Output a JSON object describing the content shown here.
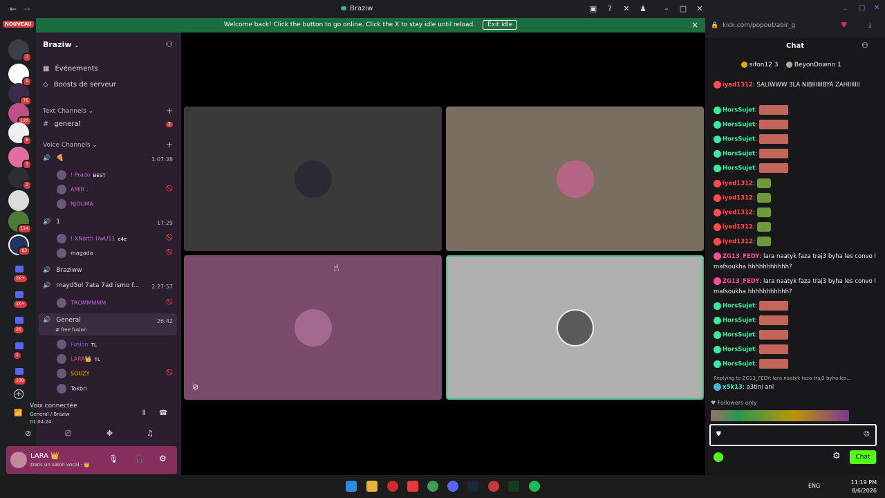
{
  "window": {
    "title": "Braziw",
    "nav_back": "←",
    "nav_forward": "→"
  },
  "banner": {
    "text": "Welcome back! Click the button to go online. Click the X to stay idle until reload.",
    "button": "Exit Idle",
    "close": "×"
  },
  "servers": {
    "nouveau": "NOUVEAU",
    "badges": [
      "7",
      "9",
      "76",
      "120",
      "6",
      "3",
      "2",
      "114",
      "83",
      "1K+",
      "1K+",
      "26",
      "1",
      "108"
    ],
    "add": "+"
  },
  "sidebar": {
    "server_name": "Braziw",
    "events": "Événements",
    "boosts": "Boosts de serveur",
    "text_category": "Text Channels",
    "text_channel": "general",
    "text_channel_badge": "7",
    "voice_category": "Voice Channels",
    "voice_channels": [
      {
        "name": "🍕",
        "timer": "1:07:38"
      },
      {
        "name": "1",
        "timer": "17:29"
      },
      {
        "name": "Braziww",
        "timer": ""
      },
      {
        "name": "mayd5ol 7ata 7ad ismo f...",
        "timer": "2:27:57"
      },
      {
        "name": "General",
        "timer": "26:42",
        "subtitle": "# free fusion"
      }
    ],
    "users": [
      {
        "name": "! Prado",
        "tag": "BEST",
        "color": "#c06adb"
      },
      {
        "name": "AMIR .",
        "tag": "",
        "color": "#c06adb"
      },
      {
        "name": "NJOUMA",
        "tag": "",
        "color": "#c06adb"
      },
      {
        "name": "! XNorth UwU11",
        "tag": "c4e",
        "color": "#c06adb"
      },
      {
        "name": "magada",
        "tag": "",
        "color": "#dbdee1"
      },
      {
        "name": "TROMMMMM",
        "tag": "",
        "color": "#c06adb"
      },
      {
        "name": "Fusion",
        "tag": "TL",
        "color": "#7b68ee"
      },
      {
        "name": "LARA👑",
        "tag": "TL",
        "color": "#e8487a"
      },
      {
        "name": "SOUZY",
        "tag": "",
        "color": "#e6b800"
      },
      {
        "name": "Tokbri",
        "tag": "",
        "color": "#dbdee1"
      }
    ]
  },
  "voice_panel": {
    "status": "Voix connectée",
    "channel": "General / Braziw",
    "timer": "01:04:24"
  },
  "user_panel": {
    "name": "LARA 👑",
    "status": "Dans un salon vocal · 👑"
  },
  "chat": {
    "url": "kick.com/popout/abir_g",
    "title": "Chat",
    "top_chatter_1": "sifon12 3",
    "top_chatter_2": "BeyonDownn 1",
    "messages": [
      {
        "user": "iyed1312",
        "text": ": SALIWWW 3LA NIBIIIIIIBYA ZAHIIIIIII",
        "color": "#ff4d4d",
        "kind": "text"
      },
      {
        "user": "HorsSujet",
        "text": ":",
        "color": "#3de99c",
        "kind": "emote"
      },
      {
        "user": "HorsSujet",
        "text": ":",
        "color": "#3de99c",
        "kind": "emote"
      },
      {
        "user": "HorsSujet",
        "text": ":",
        "color": "#3de99c",
        "kind": "emote"
      },
      {
        "user": "HorsSujet",
        "text": ":",
        "color": "#3de99c",
        "kind": "emote"
      },
      {
        "user": "HorsSujet",
        "text": ":",
        "color": "#3de99c",
        "kind": "emote"
      },
      {
        "user": "iyed1312",
        "text": ":",
        "color": "#ff4d4d",
        "kind": "emote2"
      },
      {
        "user": "iyed1312",
        "text": ":",
        "color": "#ff4d4d",
        "kind": "emote2"
      },
      {
        "user": "iyed1312",
        "text": ":",
        "color": "#ff4d4d",
        "kind": "emote2"
      },
      {
        "user": "iyed1312",
        "text": ":",
        "color": "#ff4d4d",
        "kind": "emote2"
      },
      {
        "user": "iyed1312",
        "text": ":",
        "color": "#ff4d4d",
        "kind": "emote2"
      },
      {
        "user": "ZG13_FEDY",
        "text": ": lara naatyk faza traj3 byha les convo l mafsoukha hhhhhhhhhhh?",
        "color": "#ff4d9a",
        "kind": "text"
      },
      {
        "user": "ZG13_FEDY",
        "text": ": lara naatyk faza traj3 byha les convo l mafsoukha hhhhhhhhhhh?",
        "color": "#ff4d9a",
        "kind": "text"
      },
      {
        "user": "HorsSujet",
        "text": ":",
        "color": "#3de99c",
        "kind": "emote"
      },
      {
        "user": "HorsSujet",
        "text": ":",
        "color": "#3de99c",
        "kind": "emote"
      },
      {
        "user": "HorsSujet",
        "text": ":",
        "color": "#3de99c",
        "kind": "emote"
      },
      {
        "user": "HorsSujet",
        "text": ":",
        "color": "#3de99c",
        "kind": "emote"
      },
      {
        "user": "HorsSujet",
        "text": ":",
        "color": "#3de99c",
        "kind": "emote"
      }
    ],
    "reply_hint": "Replying to ZG13_FEDY: lara naatyk faza traj3 byha les...",
    "last_user": "x5k13",
    "last_text": ": a3tini ani",
    "followers_only": "Followers only",
    "send_label": "Chat"
  },
  "taskbar": {
    "lang": "ENG",
    "time": "11:19 PM",
    "date": "8/6/2026"
  },
  "colors": {
    "banner": "#1b6c3e",
    "kick_green": "#53fc18",
    "tile_1": "#3a3a3a",
    "tile_2": "#7a6e60",
    "tile_3": "#7a4a6a",
    "tile_4": "#b0b0b0"
  }
}
